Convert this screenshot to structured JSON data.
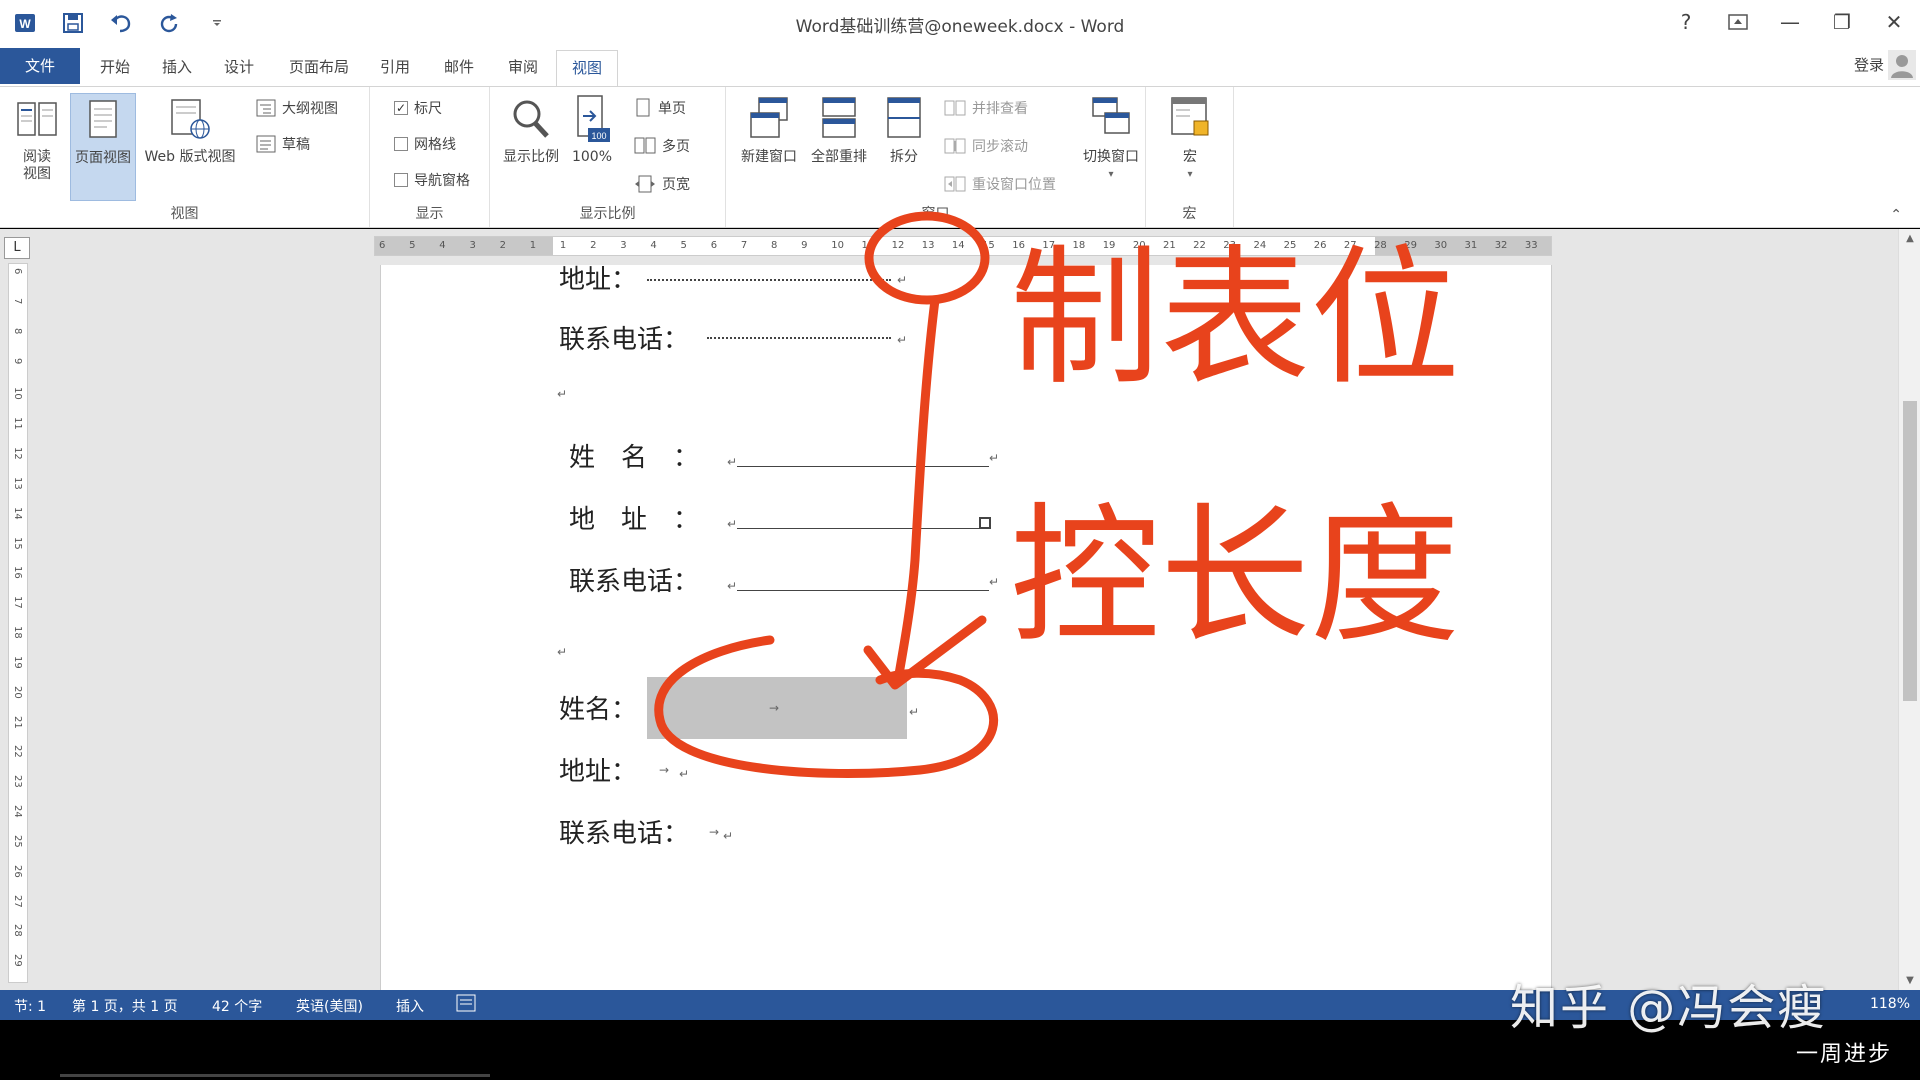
{
  "title_bar": {
    "title": "Word基础训练营@oneweek.docx - Word",
    "help": "?",
    "minimize": "—",
    "restore": "❐",
    "close": "✕"
  },
  "tabs": [
    {
      "label": "文件"
    },
    {
      "label": "开始"
    },
    {
      "label": "插入"
    },
    {
      "label": "设计"
    },
    {
      "label": "页面布局"
    },
    {
      "label": "引用"
    },
    {
      "label": "邮件"
    },
    {
      "label": "审阅"
    },
    {
      "label": "视图"
    }
  ],
  "login_label": "登录",
  "ribbon": {
    "views": {
      "label": "视图",
      "read_line1": "阅读",
      "read_line2": "视图",
      "print_layout": "页面视图",
      "web_layout": "Web 版式视图",
      "outline": "大纲视图",
      "draft": "草稿"
    },
    "show": {
      "label": "显示",
      "ruler": "标尺",
      "ruler_check": "✓",
      "gridlines": "网格线",
      "nav_pane": "导航窗格"
    },
    "zoom": {
      "label": "显示比例",
      "zoom": "显示比例",
      "hundred": "100%",
      "hundred_icon": "100",
      "one_page": "单页",
      "multi_page": "多页",
      "page_width": "页宽"
    },
    "window": {
      "label": "窗口",
      "new_window": "新建窗口",
      "arrange_all": "全部重排",
      "split": "拆分",
      "side_by_side": "并排查看",
      "sync_scroll": "同步滚动",
      "reset_position": "重设窗口位置",
      "switch_windows": "切换窗口"
    },
    "macros": {
      "label": "宏",
      "macros": "宏"
    }
  },
  "ruler_corner": "L",
  "ruler_numbers": [
    "6",
    "5",
    "4",
    "3",
    "2",
    "1",
    "1",
    "2",
    "3",
    "4",
    "5",
    "6",
    "7",
    "8",
    "9",
    "10",
    "11",
    "12",
    "13",
    "14",
    "15",
    "16",
    "17",
    "18",
    "19",
    "20",
    "21",
    "22",
    "23",
    "24",
    "25",
    "26",
    "27",
    "28",
    "29",
    "30",
    "31",
    "32",
    "33"
  ],
  "vruler_numbers": [
    "6",
    "7",
    "8",
    "9",
    "10",
    "11",
    "12",
    "13",
    "14",
    "15",
    "16",
    "17",
    "18",
    "19",
    "20",
    "21",
    "22",
    "23",
    "24",
    "25",
    "26",
    "27",
    "28",
    "29"
  ],
  "document": {
    "l1": "地址：",
    "l2": "联系电话：",
    "form2": {
      "name": "姓　名　：",
      "address": "地　址　：",
      "phone": "联系电话："
    },
    "form3": {
      "name": "姓名：",
      "address": "地址：",
      "phone": "联系电话："
    },
    "para_mark": "↵",
    "tab_mark": "→"
  },
  "annotation": {
    "line1": "制表位",
    "line2": "控长度",
    "color": "#e8431c"
  },
  "status_bar": {
    "section": "节: 1",
    "page": "第 1 页，共 1 页",
    "words": "42 个字",
    "language": "英语(美国)",
    "mode": "插入",
    "zoom": "118%"
  },
  "watermark": "知乎 @冯会瘦",
  "caption": "一周进步"
}
